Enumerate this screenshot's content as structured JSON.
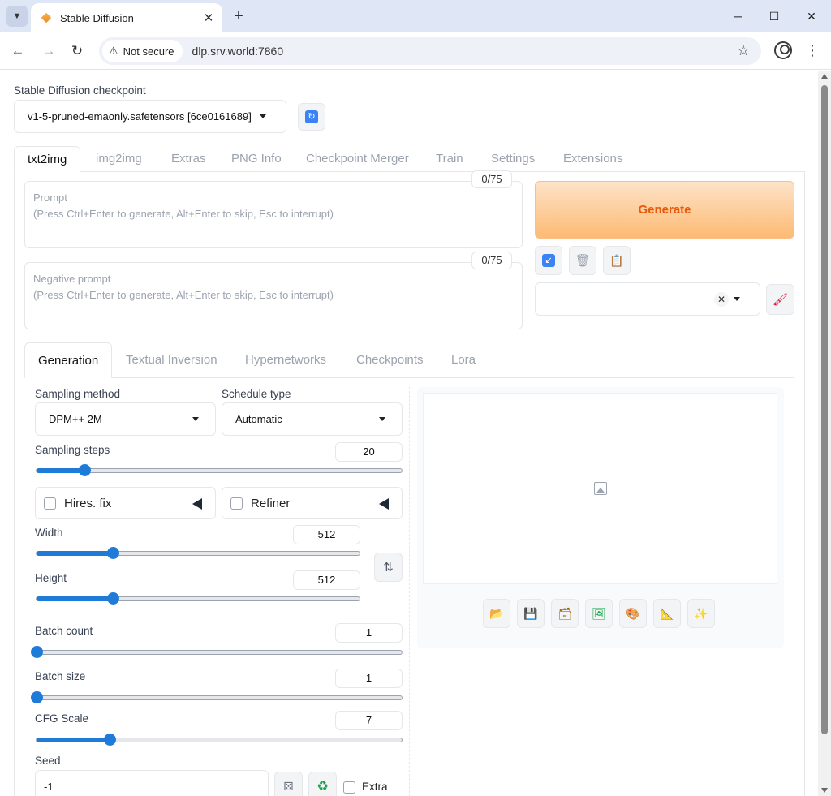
{
  "browser": {
    "tab_title": "Stable Diffusion",
    "security_label": "Not secure",
    "url": "dlp.srv.world:7860"
  },
  "checkpoint": {
    "label": "Stable Diffusion checkpoint",
    "value": "v1-5-pruned-emaonly.safetensors [6ce0161689]"
  },
  "main_tabs": [
    "txt2img",
    "img2img",
    "Extras",
    "PNG Info",
    "Checkpoint Merger",
    "Train",
    "Settings",
    "Extensions"
  ],
  "prompt": {
    "label": "Prompt",
    "hint": "(Press Ctrl+Enter to generate, Alt+Enter to skip, Esc to interrupt)",
    "counter": "0/75"
  },
  "negative_prompt": {
    "label": "Negative prompt",
    "hint": "(Press Ctrl+Enter to generate, Alt+Enter to skip, Esc to interrupt)",
    "counter": "0/75"
  },
  "generate_label": "Generate",
  "sub_tabs": [
    "Generation",
    "Textual Inversion",
    "Hypernetworks",
    "Checkpoints",
    "Lora"
  ],
  "sampling": {
    "method_label": "Sampling method",
    "method_value": "DPM++ 2M",
    "schedule_label": "Schedule type",
    "schedule_value": "Automatic",
    "steps_label": "Sampling steps",
    "steps_value": "20",
    "steps_fraction": 0.13
  },
  "hires_label": "Hires. fix",
  "refiner_label": "Refiner",
  "width": {
    "label": "Width",
    "value": "512",
    "fraction": 0.235
  },
  "height": {
    "label": "Height",
    "value": "512",
    "fraction": 0.235
  },
  "batch_count": {
    "label": "Batch count",
    "value": "1",
    "fraction": 0.0
  },
  "batch_size": {
    "label": "Batch size",
    "value": "1",
    "fraction": 0.0
  },
  "cfg": {
    "label": "CFG Scale",
    "value": "7",
    "fraction": 0.2
  },
  "seed": {
    "label": "Seed",
    "value": "-1",
    "extra_label": "Extra"
  },
  "colors": {
    "accent": "#1f7bd8",
    "generate_text": "#ea580c"
  }
}
